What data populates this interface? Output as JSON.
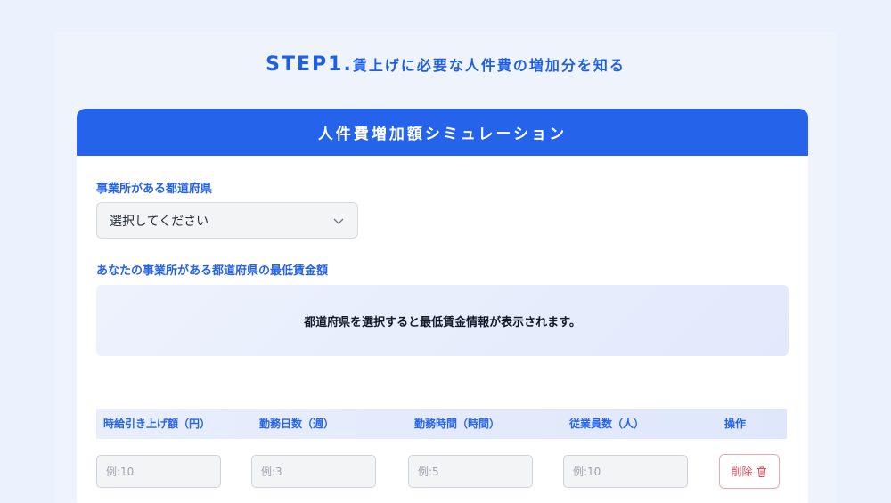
{
  "step": {
    "number_label": "STEP1.",
    "title": "賃上げに必要な人件費の増加分を知る"
  },
  "card": {
    "header": "人件費増加額シミュレーション",
    "prefecture_label": "事業所がある都道府県",
    "prefecture_select_value": "選択してください",
    "min_wage_label": "あなたの事業所がある都道府県の最低賃金額",
    "min_wage_info": "都道府県を選択すると最低賃金情報が表示されます。"
  },
  "table": {
    "headers": [
      "時給引き上げ額（円）",
      "勤務日数（週）",
      "勤務時間（時間）",
      "従業員数（人）",
      "操作"
    ],
    "row": {
      "raise_placeholder": "例:10",
      "days_placeholder": "例:3",
      "hours_placeholder": "例:5",
      "employees_placeholder": "例:10",
      "delete_label": "削除"
    }
  },
  "colors": {
    "accent": "#2563eb",
    "background": "#ecf2fd",
    "delete": "#e44b5a"
  },
  "icons": {
    "select": "chevron-down-icon",
    "delete": "trash-icon"
  }
}
